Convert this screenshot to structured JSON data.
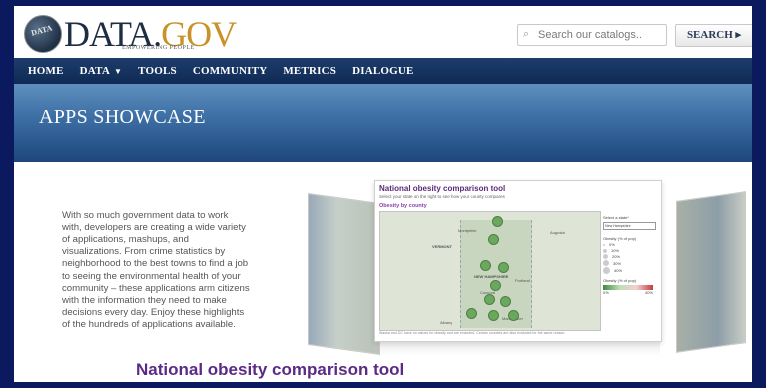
{
  "logo": {
    "globe_text": "DATA",
    "wordmark_main": "DATA.",
    "wordmark_gov": "GOV",
    "tagline": "EMPOWERING PEOPLE"
  },
  "search": {
    "placeholder": "Search our catalogs..",
    "button_label": "SEARCH ▸"
  },
  "nav": {
    "items": [
      {
        "label": "HOME"
      },
      {
        "label": "DATA",
        "has_dropdown": true
      },
      {
        "label": "TOOLS"
      },
      {
        "label": "COMMUNITY"
      },
      {
        "label": "METRICS"
      },
      {
        "label": "DIALOGUE"
      }
    ]
  },
  "banner": {
    "title": "APPS SHOWCASE"
  },
  "intro": {
    "text": "With so much government data to work with, developers are creating a wide variety of applications, mashups, and visualizations. From crime statistics by neighborhood to the best towns to find a job to seeing the environmental health of your community – these applications arm citizens with the information they need to make decisions every day. Enjoy these highlights of the hundreds of applications available."
  },
  "showcase": {
    "app_title": "National obesity comparison tool",
    "app_subtitle": "Select your state on the right to see how your county compares",
    "map_heading": "Obesity by county",
    "map_labels": {
      "vermont": "VERMONT",
      "new_hampshire": "NEW HAMPSHIRE",
      "montpelier": "Montpelier",
      "augusta": "Augusta",
      "concord": "Concord",
      "manchester": "Manchester",
      "portland": "Portland",
      "albany": "Albany"
    },
    "controls": {
      "select_label": "Select a state*",
      "selected_state": "New Hampshire",
      "size_legend_title": "Obesity (% of pop)",
      "size_legend": [
        "0%",
        "10%",
        "20%",
        "30%",
        "40%"
      ],
      "color_legend_title": "Obesity (% of pop)",
      "color_legend_min": "0%",
      "color_legend_max": "40%"
    },
    "footnote": "Alaska and DC have no values for obesity and are excluded. Certain counties are also excluded for the same reason.",
    "caption": "National obesity comparison tool"
  },
  "colors": {
    "page_background": "#0b1a5e",
    "nav_background": "#0f2a53",
    "banner_top": "#5f8fbe",
    "banner_bottom": "#1d467c",
    "caption_text": "#5b2a86",
    "logo_gov": "#c8912a"
  }
}
